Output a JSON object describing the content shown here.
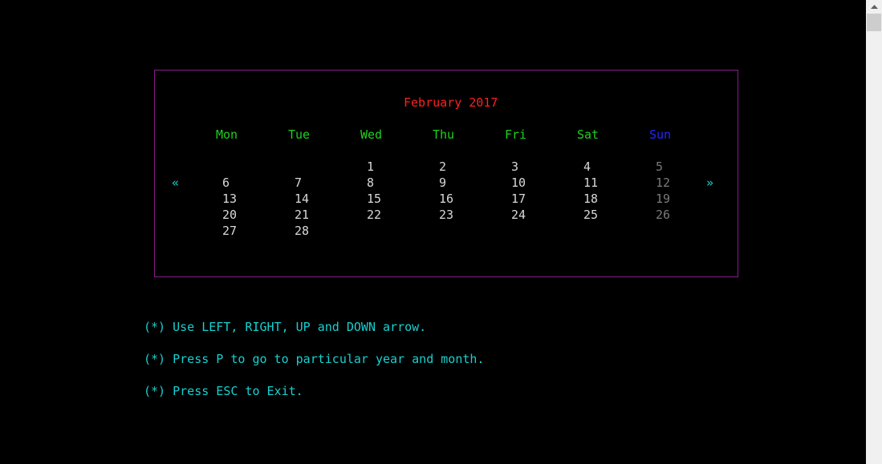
{
  "calendar": {
    "title": "February 2017",
    "weekdays": [
      "Mon",
      "Tue",
      "Wed",
      "Thu",
      "Fri",
      "Sat",
      "Sun"
    ],
    "weeks": [
      [
        "",
        "",
        "1",
        "2",
        "3",
        "4",
        "5"
      ],
      [
        "6",
        "7",
        "8",
        "9",
        "10",
        "11",
        "12"
      ],
      [
        "13",
        "14",
        "15",
        "16",
        "17",
        "18",
        "19"
      ],
      [
        "20",
        "21",
        "22",
        "23",
        "24",
        "25",
        "26"
      ],
      [
        "27",
        "28",
        "",
        "",
        "",
        "",
        ""
      ]
    ],
    "prev_arrow": "«",
    "next_arrow": "»"
  },
  "help": [
    "(*) Use LEFT, RIGHT, UP and DOWN arrow.",
    "(*) Press P to go to particular year and month.",
    "(*) Press ESC to Exit."
  ],
  "colors": {
    "title": "#ff2020",
    "weekday": "#1fd11f",
    "sunday_header": "#2525ff",
    "day": "#d8d8d8",
    "sunday_day": "#7a7a7a",
    "help": "#18d0d0",
    "border": "#8b1a8b"
  }
}
